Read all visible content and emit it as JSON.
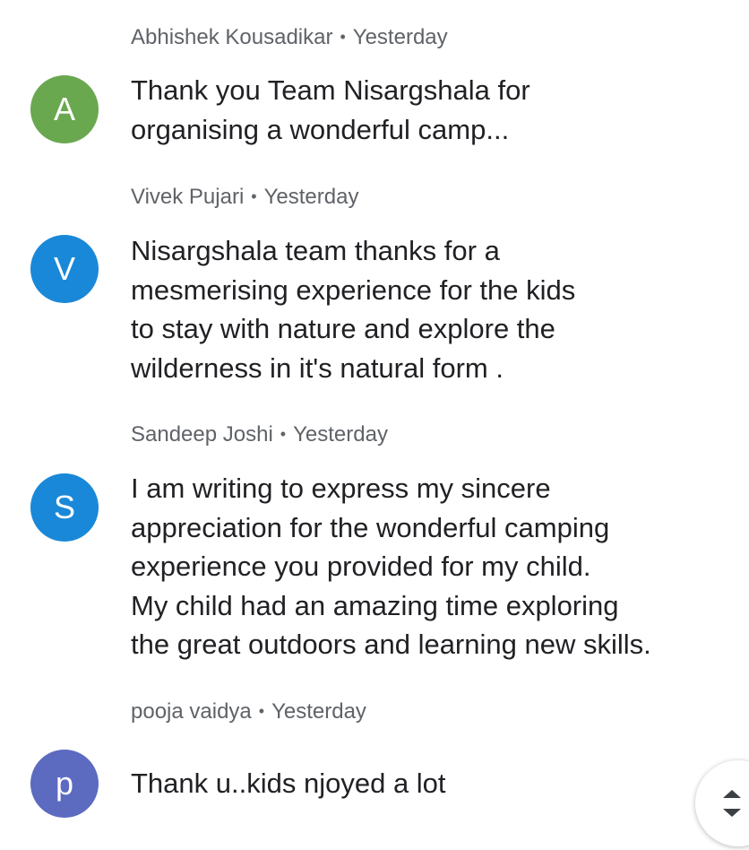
{
  "comments": [
    {
      "author": "Abhishek Kousadikar",
      "time": "Yesterday",
      "avatar_letter": "A",
      "avatar_color": "#6aa84f",
      "text": "Thank you Team Nisargshala for\norganising a wonderful camp..."
    },
    {
      "author": "Vivek Pujari",
      "time": "Yesterday",
      "avatar_letter": "V",
      "avatar_color": "#1a88d8",
      "text": "Nisargshala team thanks for a\nmesmerising experience for the kids\nto stay with nature and explore the\nwilderness in it's natural form ."
    },
    {
      "author": "Sandeep Joshi",
      "time": "Yesterday",
      "avatar_letter": "S",
      "avatar_color": "#1a88d8",
      "text": "I am writing to express my sincere\nappreciation for the wonderful camping\nexperience you provided for my child.\nMy child had an amazing time exploring\nthe great outdoors and learning new skills."
    },
    {
      "author": "pooja vaidya",
      "time": "Yesterday",
      "avatar_letter": "p",
      "avatar_color": "#5c6bc0",
      "text": "Thank u..kids njoyed a lot"
    }
  ],
  "separator": "•",
  "scroll_button": {
    "icon": "scroll-up-down-icon"
  }
}
